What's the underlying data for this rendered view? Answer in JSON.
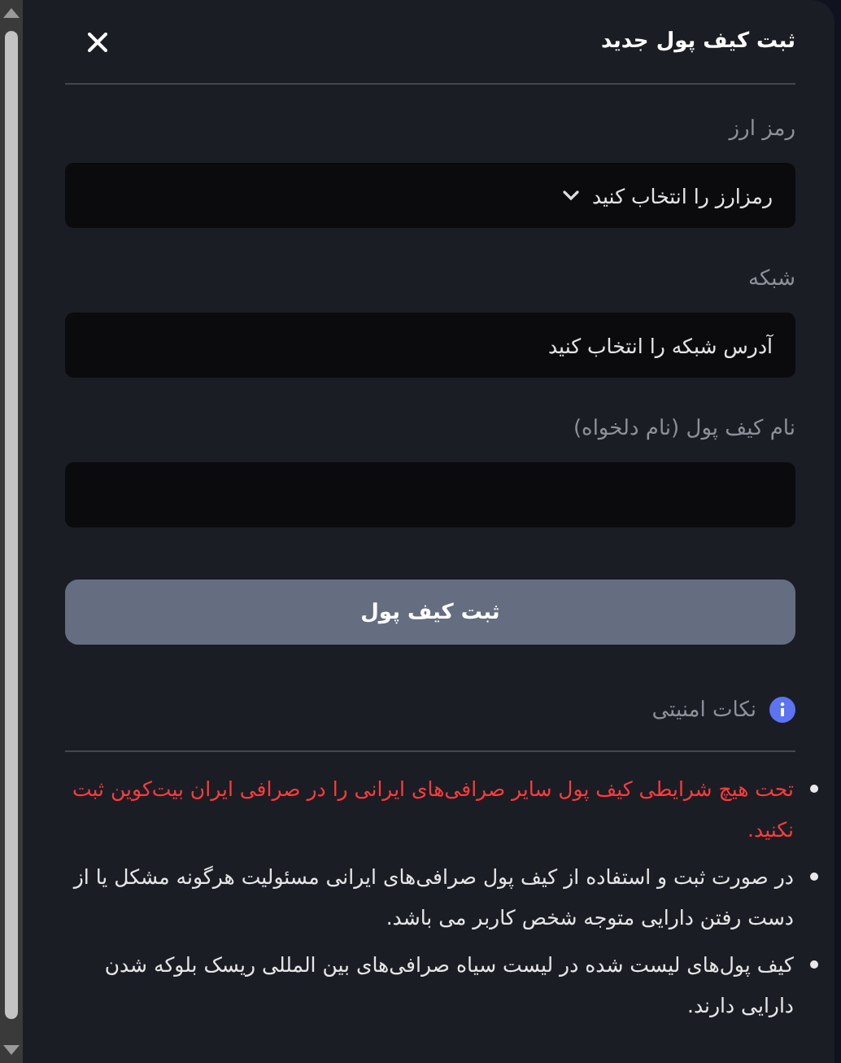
{
  "dialog": {
    "title": "ثبت کیف پول جدید"
  },
  "fields": [
    {
      "kind": "select",
      "label": "رمز ارز",
      "placeholder": "رمزارز را انتخاب کنید"
    },
    {
      "kind": "picker",
      "label": "شبکه",
      "placeholder": "آدرس شبکه را انتخاب کنید"
    },
    {
      "kind": "text",
      "label": "نام کیف پول (نام دلخواه)"
    }
  ],
  "submit_button": {
    "label": "ثبت کیف پول",
    "disabled": true
  },
  "security_notes": {
    "title": "نکات امنیتی",
    "items": [
      {
        "kind": "warning",
        "text": "تحت هیچ شرایطی کیف پول سایر صرافی‌های ایرانی را در صرافی ایران بیت‌کوین ثبت نکنید."
      },
      {
        "kind": "normal",
        "text": "در صورت ثبت و استفاده از کیف پول صرافی‌های ایرانی مسئولیت هرگونه مشکل یا از دست رفتن دارایی متوجه شخص کاربر می باشد."
      },
      {
        "kind": "normal",
        "text": "کیف پول‌های لیست شده در لیست سیاه صرافی‌های بین المللی ریسک بلوکه شدن دارایی دارند."
      }
    ]
  }
}
